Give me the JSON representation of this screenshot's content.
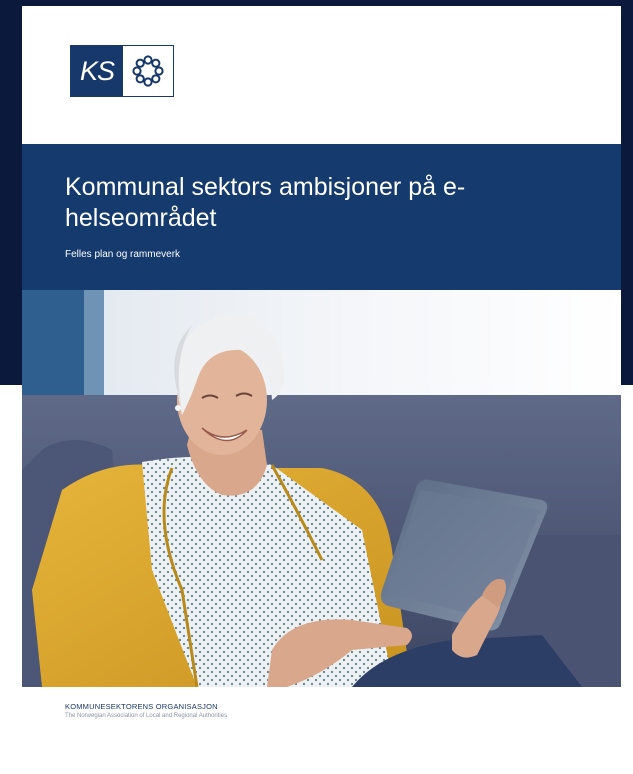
{
  "brand": {
    "logo_text": "KS",
    "navy": "#0b1a3c",
    "accent": "#143a6e",
    "emblem_icon": "chain-ring-icon"
  },
  "cover": {
    "title": "Kommunal sektors ambisjoner på e-helseområdet",
    "subtitle": "Felles plan og rammeverk"
  },
  "photo": {
    "description_icon": "elderly-woman-with-tablet-image"
  },
  "footer": {
    "org_name": "KOMMUNESEKTORENS ORGANISASJON",
    "org_name_english": "The Norwegian Association of Local and Regional Authorities"
  }
}
